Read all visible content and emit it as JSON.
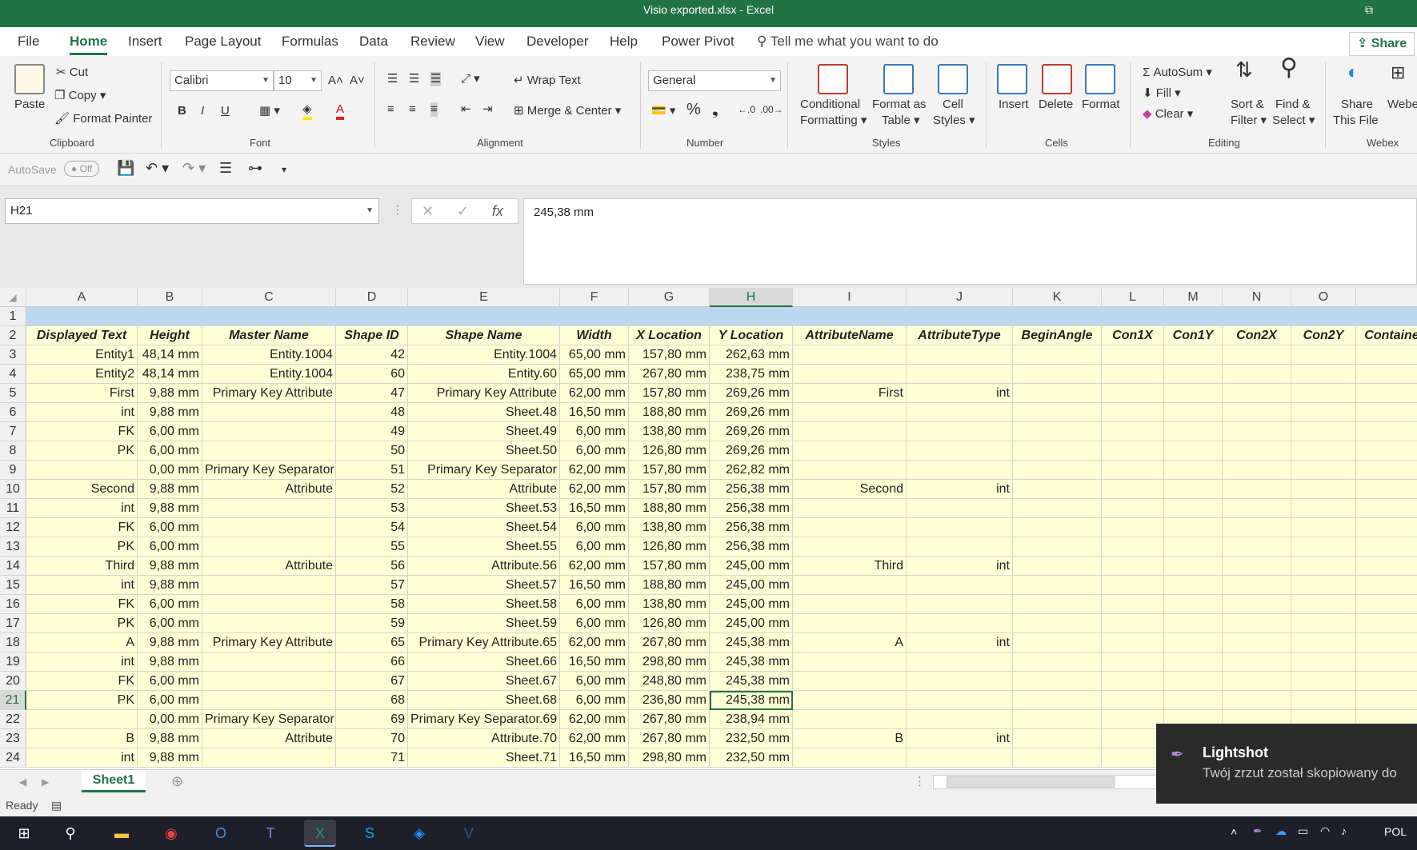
{
  "window": {
    "title": "Visio exported.xlsx  -  Excel"
  },
  "tabs": [
    "File",
    "Home",
    "Insert",
    "Page Layout",
    "Formulas",
    "Data",
    "Review",
    "View",
    "Developer",
    "Help",
    "Power Pivot"
  ],
  "tell_me": "Tell me what you want to do",
  "share_label": "Share",
  "ribbon": {
    "clipboard": {
      "paste": "Paste",
      "cut": "Cut",
      "copy": "Copy",
      "format_painter": "Format Painter",
      "label": "Clipboard"
    },
    "font": {
      "name": "Calibri",
      "size": "10",
      "label": "Font",
      "bold": "B",
      "italic": "I",
      "underline": "U"
    },
    "alignment": {
      "wrap": "Wrap Text",
      "merge": "Merge & Center",
      "label": "Alignment"
    },
    "number": {
      "format": "General",
      "label": "Number"
    },
    "styles": {
      "conditional": "Conditional",
      "conditional2": "Formatting",
      "format_as": "Format as",
      "format_as2": "Table",
      "cell": "Cell",
      "cell2": "Styles",
      "label": "Styles"
    },
    "cells": {
      "insert": "Insert",
      "delete": "Delete",
      "format": "Format",
      "label": "Cells"
    },
    "editing": {
      "autosum": "AutoSum",
      "fill": "Fill",
      "clear": "Clear",
      "sort": "Sort &",
      "sort2": "Filter",
      "find": "Find &",
      "find2": "Select",
      "label": "Editing"
    },
    "webex": {
      "share": "Share",
      "share2": "This File",
      "webex": "Webe",
      "label": "Webex"
    }
  },
  "qat": {
    "autosave": "AutoSave",
    "off": "Off"
  },
  "name_box": "H21",
  "formula_value": "245,38 mm",
  "columns": [
    "A",
    "B",
    "C",
    "D",
    "E",
    "F",
    "G",
    "H",
    "I",
    "J",
    "K",
    "L",
    "M",
    "N",
    "O"
  ],
  "headers": [
    "Displayed Text",
    "Height",
    "Master Name",
    "Shape ID",
    "Shape Name",
    "Width",
    "X Location",
    "Y Location",
    "AttributeName",
    "AttributeType",
    "BeginAngle",
    "Con1X",
    "Con1Y",
    "Con2X",
    "Con2Y",
    "Containe"
  ],
  "rows": [
    [
      "Entity1",
      "48,14 mm",
      "Entity.1004",
      "42",
      "Entity.1004",
      "65,00 mm",
      "157,80 mm",
      "262,63 mm",
      "",
      ""
    ],
    [
      "Entity2",
      "48,14 mm",
      "Entity.1004",
      "60",
      "Entity.60",
      "65,00 mm",
      "267,80 mm",
      "238,75 mm",
      "",
      ""
    ],
    [
      "First",
      "9,88 mm",
      "Primary Key Attribute",
      "47",
      "Primary Key Attribute",
      "62,00 mm",
      "157,80 mm",
      "269,26 mm",
      "First",
      "int"
    ],
    [
      "int",
      "9,88 mm",
      "",
      "48",
      "Sheet.48",
      "16,50 mm",
      "188,80 mm",
      "269,26 mm",
      "",
      ""
    ],
    [
      "FK",
      "6,00 mm",
      "",
      "49",
      "Sheet.49",
      "6,00 mm",
      "138,80 mm",
      "269,26 mm",
      "",
      ""
    ],
    [
      "PK",
      "6,00 mm",
      "",
      "50",
      "Sheet.50",
      "6,00 mm",
      "126,80 mm",
      "269,26 mm",
      "",
      ""
    ],
    [
      "",
      "0,00 mm",
      "Primary Key Separator",
      "51",
      "Primary Key Separator",
      "62,00 mm",
      "157,80 mm",
      "262,82 mm",
      "",
      ""
    ],
    [
      "Second",
      "9,88 mm",
      "Attribute",
      "52",
      "Attribute",
      "62,00 mm",
      "157,80 mm",
      "256,38 mm",
      "Second",
      "int"
    ],
    [
      "int",
      "9,88 mm",
      "",
      "53",
      "Sheet.53",
      "16,50 mm",
      "188,80 mm",
      "256,38 mm",
      "",
      ""
    ],
    [
      "FK",
      "6,00 mm",
      "",
      "54",
      "Sheet.54",
      "6,00 mm",
      "138,80 mm",
      "256,38 mm",
      "",
      ""
    ],
    [
      "PK",
      "6,00 mm",
      "",
      "55",
      "Sheet.55",
      "6,00 mm",
      "126,80 mm",
      "256,38 mm",
      "",
      ""
    ],
    [
      "Third",
      "9,88 mm",
      "Attribute",
      "56",
      "Attribute.56",
      "62,00 mm",
      "157,80 mm",
      "245,00 mm",
      "Third",
      "int"
    ],
    [
      "int",
      "9,88 mm",
      "",
      "57",
      "Sheet.57",
      "16,50 mm",
      "188,80 mm",
      "245,00 mm",
      "",
      ""
    ],
    [
      "FK",
      "6,00 mm",
      "",
      "58",
      "Sheet.58",
      "6,00 mm",
      "138,80 mm",
      "245,00 mm",
      "",
      ""
    ],
    [
      "PK",
      "6,00 mm",
      "",
      "59",
      "Sheet.59",
      "6,00 mm",
      "126,80 mm",
      "245,00 mm",
      "",
      ""
    ],
    [
      "A",
      "9,88 mm",
      "Primary Key Attribute",
      "65",
      "Primary Key Attribute.65",
      "62,00 mm",
      "267,80 mm",
      "245,38 mm",
      "A",
      "int"
    ],
    [
      "int",
      "9,88 mm",
      "",
      "66",
      "Sheet.66",
      "16,50 mm",
      "298,80 mm",
      "245,38 mm",
      "",
      ""
    ],
    [
      "FK",
      "6,00 mm",
      "",
      "67",
      "Sheet.67",
      "6,00 mm",
      "248,80 mm",
      "245,38 mm",
      "",
      ""
    ],
    [
      "PK",
      "6,00 mm",
      "",
      "68",
      "Sheet.68",
      "6,00 mm",
      "236,80 mm",
      "245,38 mm",
      "",
      ""
    ],
    [
      "",
      "0,00 mm",
      "Primary Key Separator",
      "69",
      "Primary Key Separator.69",
      "62,00 mm",
      "267,80 mm",
      "238,94 mm",
      "",
      ""
    ],
    [
      "B",
      "9,88 mm",
      "Attribute",
      "70",
      "Attribute.70",
      "62,00 mm",
      "267,80 mm",
      "232,50 mm",
      "B",
      "int"
    ],
    [
      "int",
      "9,88 mm",
      "",
      "71",
      "Sheet.71",
      "16,50 mm",
      "298,80 mm",
      "232,50 mm",
      "",
      ""
    ]
  ],
  "sheet_tab": "Sheet1",
  "status": "Ready",
  "toast": {
    "title": "Lightshot",
    "message": "Twój zrzut został skopiowany do"
  },
  "tray": {
    "lang": "POL"
  },
  "colors": {
    "excel_green": "#217346",
    "cell_fill": "#ffffd5",
    "band_fill": "#bdd7ee"
  }
}
